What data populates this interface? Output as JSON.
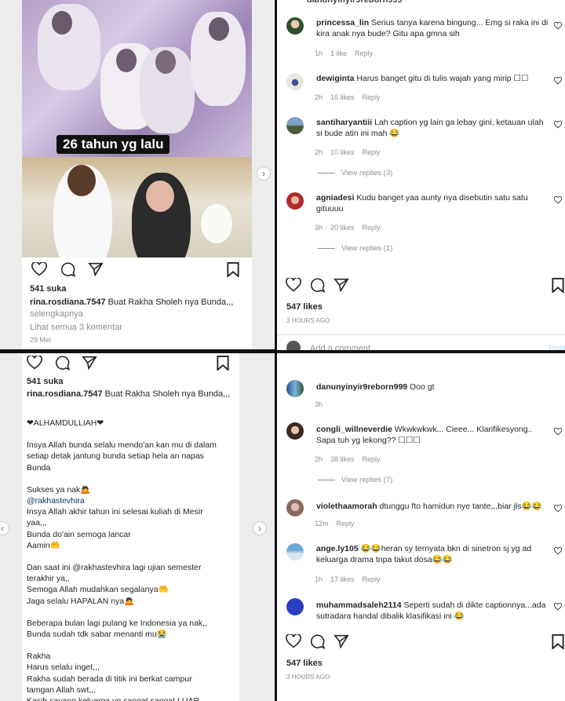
{
  "top_left": {
    "photo_caption": "26 tahun yg lalu",
    "likes": "541 suka",
    "username": "rina.rosdiana.7547",
    "caption_preview": "Buat Rakha Sholeh nya Bunda,,,",
    "more": "selengkapnya",
    "view_comments": "Lihat semua 3 komentar",
    "date": "29 Mei"
  },
  "top_right": {
    "header_user": "danunyinyir9reborn999",
    "comments": [
      {
        "user": "princessa_lin",
        "text": "Serius tanya karena bingung... Emg si raka ini di kira anak nya bude? Gitu apa gmna sih",
        "time": "1h",
        "likes": "1 like",
        "reply": "Reply"
      },
      {
        "user": "dewiginta",
        "text": "Harus banget gitu di tulis wajah yang mirip ☐☐",
        "time": "2h",
        "likes": "16 likes",
        "reply": "Reply"
      },
      {
        "user": "santiharyantiii",
        "text": "Lah caption yg lain ga lebay gini, ketauan ulah si bude atin ini mah 😂",
        "time": "2h",
        "likes": "10 likes",
        "reply": "Reply",
        "view_replies": "View replies (3)"
      },
      {
        "user": "agniadesi",
        "text": "Kudu banget yaa aunty nya disebutin satu satu gituuuu",
        "time": "3h",
        "likes": "20 likes",
        "reply": "Reply",
        "view_replies": "View replies (1)"
      }
    ],
    "likes": "547 likes",
    "time_ago": "3 HOURS AGO",
    "add_comment": "Add a comment...",
    "post": "Post"
  },
  "bottom_left": {
    "likes": "541 suka",
    "username": "rina.rosdiana.7547",
    "caption_title": "Buat Rakha Sholeh nya Bunda,,,",
    "caption_lines": [
      "",
      "❤ALHAMDULLIAH❤",
      "",
      "Insya Allah bunda selalu mendo'an kan mu  di dalam",
      "setiap detak jantung bunda setiap hela an napas",
      "Bunda",
      "",
      "Sukses ya nak🙇",
      "@rakhastevhira",
      "Insya Allah akhir tahun ini selesai  kuliah di Mesir",
      "yaa,,,",
      "Bunda do'ain semoga lancar",
      "Aamin🤲",
      "",
      "Dan saat ini @rakhastevhira  lagi ujian semester",
      "terakhir ya,,",
      "Semoga Allah mudahkan segalanya🤲",
      "Jaga selalu HAPALAN nya🙇",
      "",
      "Beberapa bulan lagi pulang ke Indonesia ya nak,,",
      "Bunda sudah tdk sabar menanti mu😭",
      "",
      "Rakha",
      "Harus selalu inget,,,",
      "Rakha  sudah berada di titik ini berkat campur",
      "tamgan Allah swt,,,",
      "Kasih sayang keluarga yg  sangat sangat LUAR"
    ]
  },
  "bottom_right": {
    "comments": [
      {
        "user": "danunyinyir9reborn999",
        "text": "Ooo gt",
        "time": "3h"
      },
      {
        "user": "congli_willneverdie",
        "text": "Wkwkwkwk... Cieee... Klarifikesyong.. Sapa tuh yg lekong?? ☐☐☐",
        "time": "2h",
        "likes": "38 likes",
        "reply": "Reply",
        "view_replies": "View replies (7)"
      },
      {
        "user": "violethaamorah",
        "text": "dtunggu fto hamidun nye tante,,,biar jls😂😂",
        "time": "12m",
        "reply": "Reply"
      },
      {
        "user": "ange.ly105",
        "text": "😂😂heran sy ternyata bkn di sinetron sj yg ad keluarga drama tnpa takut dosa😂😂",
        "time": "1h",
        "likes": "17 likes",
        "reply": "Reply"
      },
      {
        "user": "muhammadsaleh2114",
        "text": "Seperti sudah di dikte captionnya...ada sutradara handal dibalik klasifikasi ini 😂",
        "time": ""
      }
    ],
    "likes": "547 likes",
    "time_ago": "3 HOURS AGO"
  }
}
